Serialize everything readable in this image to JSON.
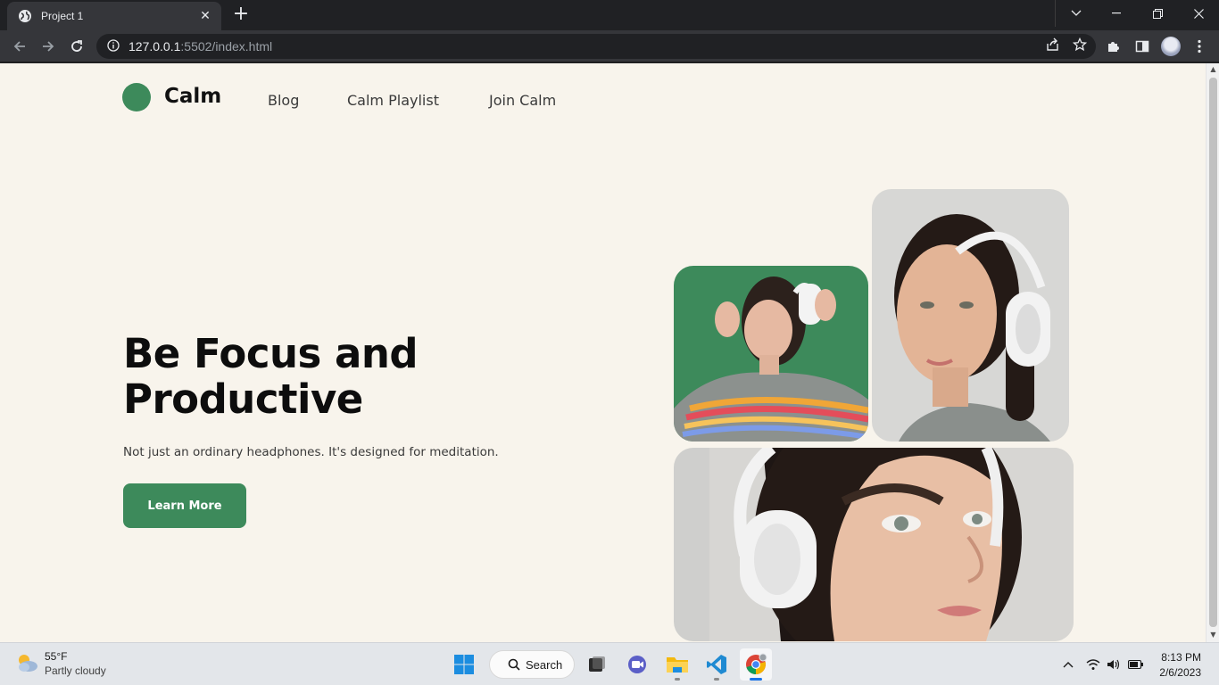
{
  "browser": {
    "tab": {
      "title": "Project 1",
      "close_label": "✕"
    },
    "new_tab_label": "+",
    "address": {
      "host": "127.0.0.1",
      "rest": ":5502/index.html"
    },
    "icons": {
      "back": "back-arrow-icon",
      "forward": "forward-arrow-icon",
      "reload": "reload-icon",
      "info": "site-info-icon",
      "share": "share-icon",
      "bookmark": "star-icon",
      "extensions": "puzzle-icon",
      "sidepanel": "side-panel-icon",
      "menu": "kebab-menu-icon"
    },
    "window_controls": [
      "chevron-down-icon",
      "minimize-icon",
      "restore-icon",
      "close-icon"
    ]
  },
  "site": {
    "logo": {
      "text": "Calm",
      "dot_color": "#3d8a5b"
    },
    "nav": [
      {
        "label": "Blog"
      },
      {
        "label": "Calm Playlist"
      },
      {
        "label": "Join Calm"
      }
    ],
    "hero": {
      "title": "Be Focus and Productive",
      "subtitle": "Not just an ordinary headphones. It's designed for meditation.",
      "cta_label": "Learn More"
    },
    "accent_color": "#3d8a5b",
    "background_color": "#f8f4ec",
    "images": [
      {
        "name": "woman-headphones-green-bg"
      },
      {
        "name": "woman-headphones-portrait"
      },
      {
        "name": "woman-headphones-closeup"
      }
    ]
  },
  "taskbar": {
    "weather": {
      "temp": "55°F",
      "desc": "Partly cloudy"
    },
    "search_label": "Search",
    "apps": [
      "windows-start-icon",
      "search-icon",
      "task-view-icon",
      "chat-icon",
      "file-explorer-icon",
      "vscode-icon",
      "chrome-icon"
    ],
    "tray_icons": [
      "chevron-up-icon",
      "wifi-icon",
      "volume-icon",
      "battery-icon"
    ],
    "clock": {
      "time": "8:13 PM",
      "date": "2/6/2023"
    }
  }
}
